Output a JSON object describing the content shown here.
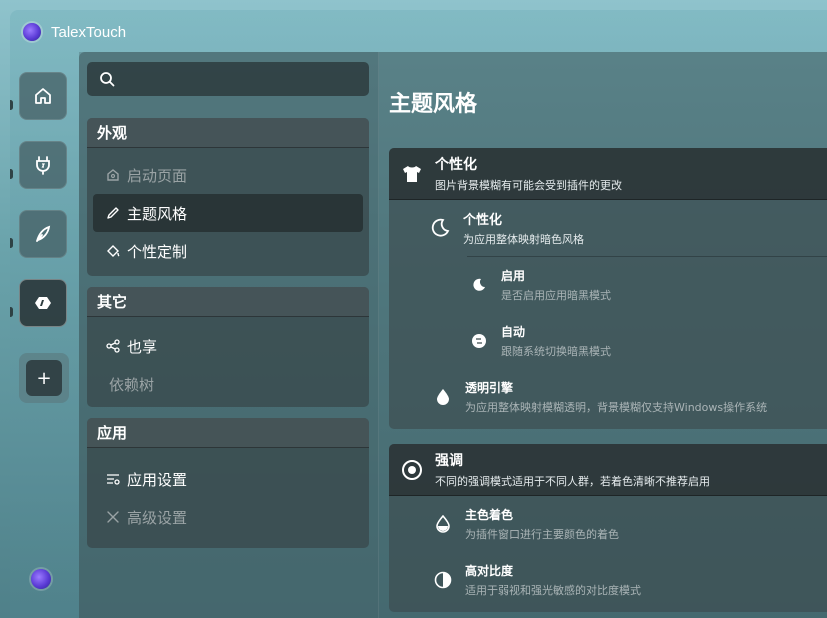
{
  "app": {
    "title": "TalexTouch"
  },
  "search": {
    "placeholder": "",
    "value": ""
  },
  "nav": {
    "groups": [
      {
        "title": "外观",
        "items": [
          {
            "label": "启动页面",
            "icon": "home-outline-icon",
            "disabled": true
          },
          {
            "label": "主题风格",
            "icon": "pencil-icon",
            "selected": true
          },
          {
            "label": "个性定制",
            "icon": "paint-bucket-icon"
          }
        ]
      },
      {
        "title": "其它",
        "items": [
          {
            "label": "也享",
            "icon": "share-icon"
          },
          {
            "label": "依赖树",
            "icon": "",
            "disabled": true
          }
        ]
      },
      {
        "title": "应用",
        "items": [
          {
            "label": "应用设置",
            "icon": "settings-list-icon"
          },
          {
            "label": "高级设置",
            "icon": "tools-icon",
            "disabled": true
          }
        ]
      }
    ]
  },
  "page": {
    "title": "主题风格",
    "personalize_card": {
      "title": "个性化",
      "desc": "图片背景模糊有可能会受到插件的更改",
      "sub": {
        "title": "个性化",
        "desc": "为应用整体映射暗色风格",
        "options": [
          {
            "title": "启用",
            "desc": "是否启用应用暗黑模式"
          },
          {
            "title": "自动",
            "desc": "跟随系统切换暗黑模式"
          }
        ]
      },
      "transparent": {
        "title": "透明引擎",
        "desc": "为应用整体映射模糊透明，背景模糊仅支持Windows操作系统"
      }
    },
    "accent_card": {
      "title": "强调",
      "desc": "不同的强调模式适用于不同人群，若着色清晰不推荐启用",
      "items": [
        {
          "title": "主色着色",
          "desc": "为插件窗口进行主要颜色的着色"
        },
        {
          "title": "高对比度",
          "desc": "适用于弱视和强光敏感的对比度模式"
        }
      ]
    }
  },
  "colors": {
    "accent": "#5b3bd6"
  }
}
